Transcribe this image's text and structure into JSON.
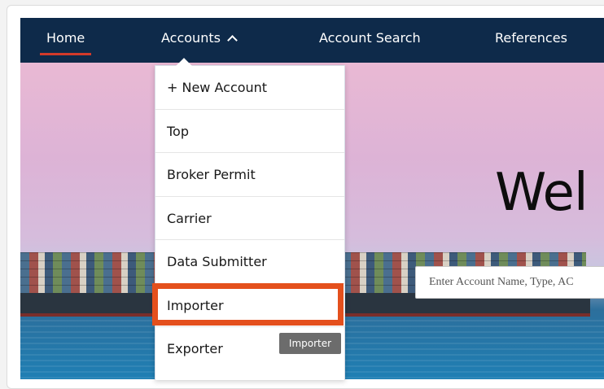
{
  "nav": {
    "home": "Home",
    "accounts": "Accounts",
    "account_search": "Account Search",
    "references": "References"
  },
  "dropdown": {
    "items": [
      {
        "label": "+ New Account"
      },
      {
        "label": "Top"
      },
      {
        "label": "Broker Permit"
      },
      {
        "label": "Carrier"
      },
      {
        "label": "Data Submitter"
      },
      {
        "label": "Importer"
      },
      {
        "label": "Exporter"
      }
    ]
  },
  "hero": {
    "welcome_text": "Wel",
    "search_placeholder": "Enter Account Name, Type, AC"
  },
  "tooltip": {
    "text": "Importer"
  },
  "icons": {
    "accounts_chevron": "chevron-up-icon"
  },
  "colors": {
    "navbar": "#0e2a4a",
    "active_underline": "#d23a2a",
    "highlight_box": "#e4501d",
    "tooltip_bg": "#6c6c6c"
  }
}
